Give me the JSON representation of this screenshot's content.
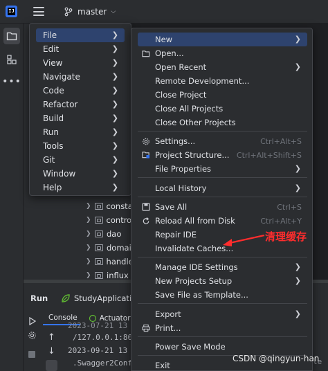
{
  "titlebar": {
    "logo_text": "IJ",
    "branch_name": "master"
  },
  "project_tree": {
    "rows": [
      {
        "label": "consta"
      },
      {
        "label": "contro"
      },
      {
        "label": "dao"
      },
      {
        "label": "domai"
      },
      {
        "label": "handle"
      },
      {
        "label": "influx"
      }
    ]
  },
  "run_panel": {
    "title": "Run",
    "tab_label": "StudyApplication",
    "console_tab": "Console",
    "actuator_tab": "Actuator",
    "lines": [
      "2023-07-21 13",
      "/127.0.0.1:80",
      "2023-09-21 13",
      ".Swagger2Conf"
    ]
  },
  "main_menu": {
    "items": [
      {
        "label": "File",
        "selected": true
      },
      {
        "label": "Edit"
      },
      {
        "label": "View"
      },
      {
        "label": "Navigate"
      },
      {
        "label": "Code"
      },
      {
        "label": "Refactor"
      },
      {
        "label": "Build"
      },
      {
        "label": "Run"
      },
      {
        "label": "Tools"
      },
      {
        "label": "Git"
      },
      {
        "label": "Window"
      },
      {
        "label": "Help"
      }
    ]
  },
  "file_menu": {
    "new": "New",
    "open": "Open...",
    "open_recent": "Open Recent",
    "remote_development": "Remote Development...",
    "close_project": "Close Project",
    "close_all_projects": "Close All Projects",
    "close_other_projects": "Close Other Projects",
    "settings": "Settings...",
    "settings_shortcut": "Ctrl+Alt+S",
    "project_structure": "Project Structure...",
    "project_structure_shortcut": "Ctrl+Alt+Shift+S",
    "file_properties": "File Properties",
    "local_history": "Local History",
    "save_all": "Save All",
    "save_all_shortcut": "Ctrl+S",
    "reload_all": "Reload All from Disk",
    "reload_all_shortcut": "Ctrl+Alt+Y",
    "repair_ide": "Repair IDE",
    "invalidate_caches": "Invalidate Caches...",
    "manage_ide_settings": "Manage IDE Settings",
    "new_projects_setup": "New Projects Setup",
    "save_file_as_template": "Save File as Template...",
    "export": "Export",
    "print": "Print...",
    "power_save_mode": "Power Save Mode",
    "exit": "Exit"
  },
  "annotation": {
    "text": "清理缓存",
    "color": "#ff2d2d"
  },
  "watermark": "CSDN @qingyun-han",
  "editor_fragment": "le"
}
